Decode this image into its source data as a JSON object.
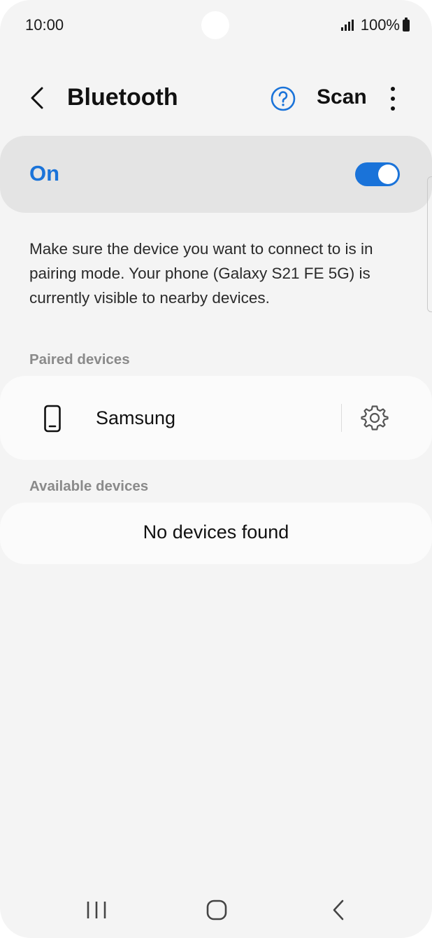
{
  "status_bar": {
    "time": "10:00",
    "battery": "100%",
    "icons": [
      "signal-icon",
      "battery-icon"
    ]
  },
  "header": {
    "back_icon": "chevron-left-icon",
    "title": "Bluetooth",
    "help_icon": "question-circle-icon",
    "scan_label": "Scan",
    "more_icon": "more-vertical-icon"
  },
  "master_toggle": {
    "label": "On",
    "checked": true
  },
  "description": "Make sure the device you want to connect to is in pairing mode. Your phone (Galaxy S21 FE 5G) is currently visible to nearby devices.",
  "paired_devices": {
    "title": "Paired devices",
    "items": [
      {
        "name": "Samsung",
        "icon": "phone-icon",
        "settings_icon": "gear-icon"
      }
    ]
  },
  "available_devices": {
    "title": "Available devices",
    "empty_text": "No devices found"
  },
  "nav_bar": {
    "icons": [
      "recents-icon",
      "home-icon",
      "back-icon"
    ]
  },
  "colors": {
    "accent": "#1a73d9",
    "background": "#f4f4f4",
    "toggle_card": "#e4e4e4",
    "card": "#fbfbfb",
    "section_title": "#8a8a8a"
  }
}
